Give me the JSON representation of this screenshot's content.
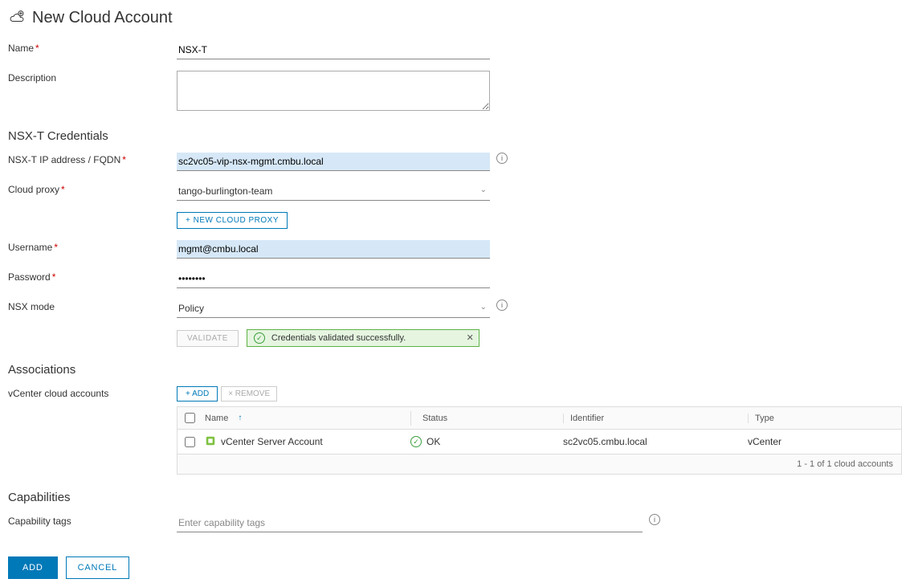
{
  "title": "New Cloud Account",
  "fields": {
    "name_label": "Name",
    "name_value": "NSX-T",
    "description_label": "Description",
    "description_value": ""
  },
  "creds": {
    "section": "NSX-T Credentials",
    "fqdn_label": "NSX-T IP address / FQDN",
    "fqdn_value": "sc2vc05-vip-nsx-mgmt.cmbu.local",
    "proxy_label": "Cloud proxy",
    "proxy_value": "tango-burlington-team",
    "new_proxy_btn": "+ New Cloud Proxy",
    "username_label": "Username",
    "username_value": "mgmt@cmbu.local",
    "password_label": "Password",
    "password_value": "••••••••",
    "mode_label": "NSX mode",
    "mode_value": "Policy",
    "validate_btn": "Validate",
    "validate_msg": "Credentials validated successfully."
  },
  "assoc": {
    "section": "Associations",
    "label": "vCenter cloud accounts",
    "add_btn": "+ Add",
    "remove_btn": "× Remove",
    "cols": {
      "name": "Name",
      "status": "Status",
      "identifier": "Identifier",
      "type": "Type"
    },
    "rows": [
      {
        "name": "vCenter Server Account",
        "status": "OK",
        "identifier": "sc2vc05.cmbu.local",
        "type": "vCenter"
      }
    ],
    "footer": "1 - 1 of 1 cloud accounts"
  },
  "caps": {
    "section": "Capabilities",
    "label": "Capability tags",
    "placeholder": "Enter capability tags"
  },
  "footer": {
    "add": "ADD",
    "cancel": "CANCEL"
  }
}
